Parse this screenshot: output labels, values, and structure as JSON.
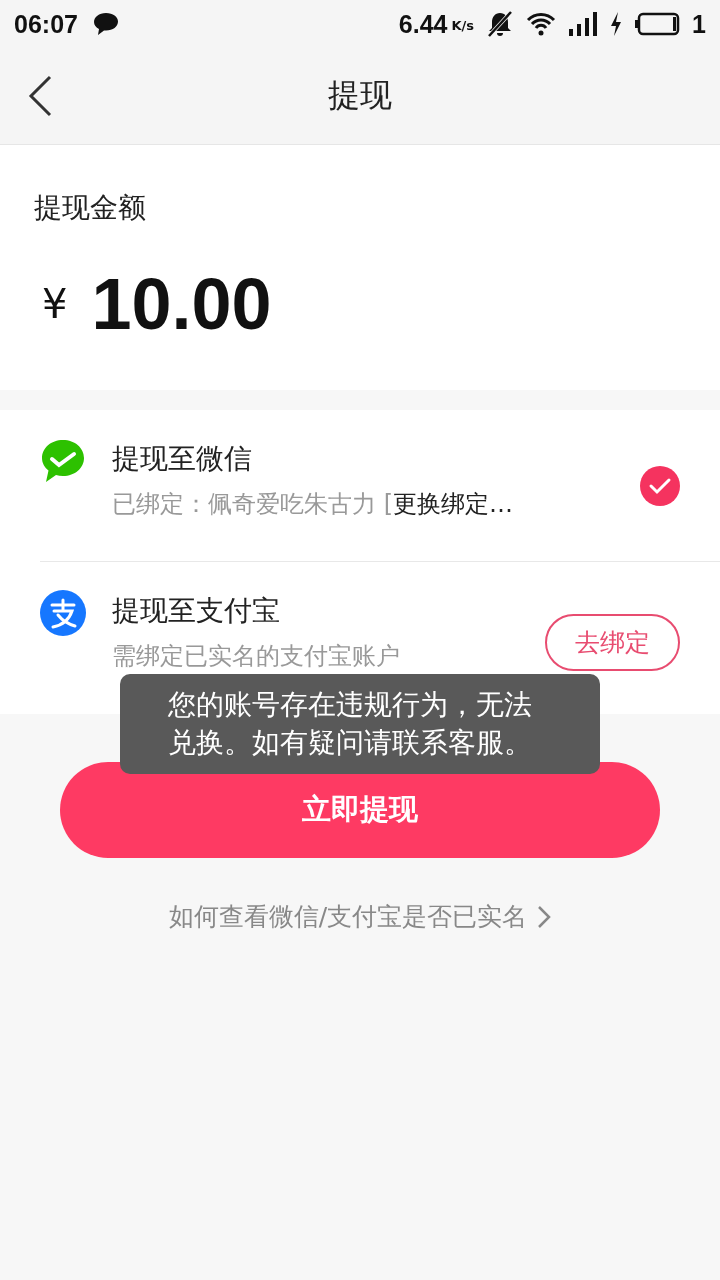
{
  "status_bar": {
    "time": "06:07",
    "speed": "6.44",
    "speed_unit": "K/s",
    "battery": "1"
  },
  "nav": {
    "title": "提现"
  },
  "amount": {
    "label": "提现金额",
    "currency": "¥",
    "value": "10.00"
  },
  "methods": [
    {
      "kind": "wechat",
      "title": "提现至微信",
      "subtitle": "已绑定：佩奇爱吃朱古力 [",
      "action": "更换绑定…",
      "selected": true
    },
    {
      "kind": "alipay",
      "title": "提现至支付宝",
      "subtitle": "需绑定已实名的支付宝账户",
      "bind_button": "去绑定",
      "selected": false
    }
  ],
  "submit_button": "立即提现",
  "help_link": "如何查看微信/支付宝是否已实名",
  "toast": "您的账号存在违规行为，无法兑换。如有疑问请联系客服。"
}
